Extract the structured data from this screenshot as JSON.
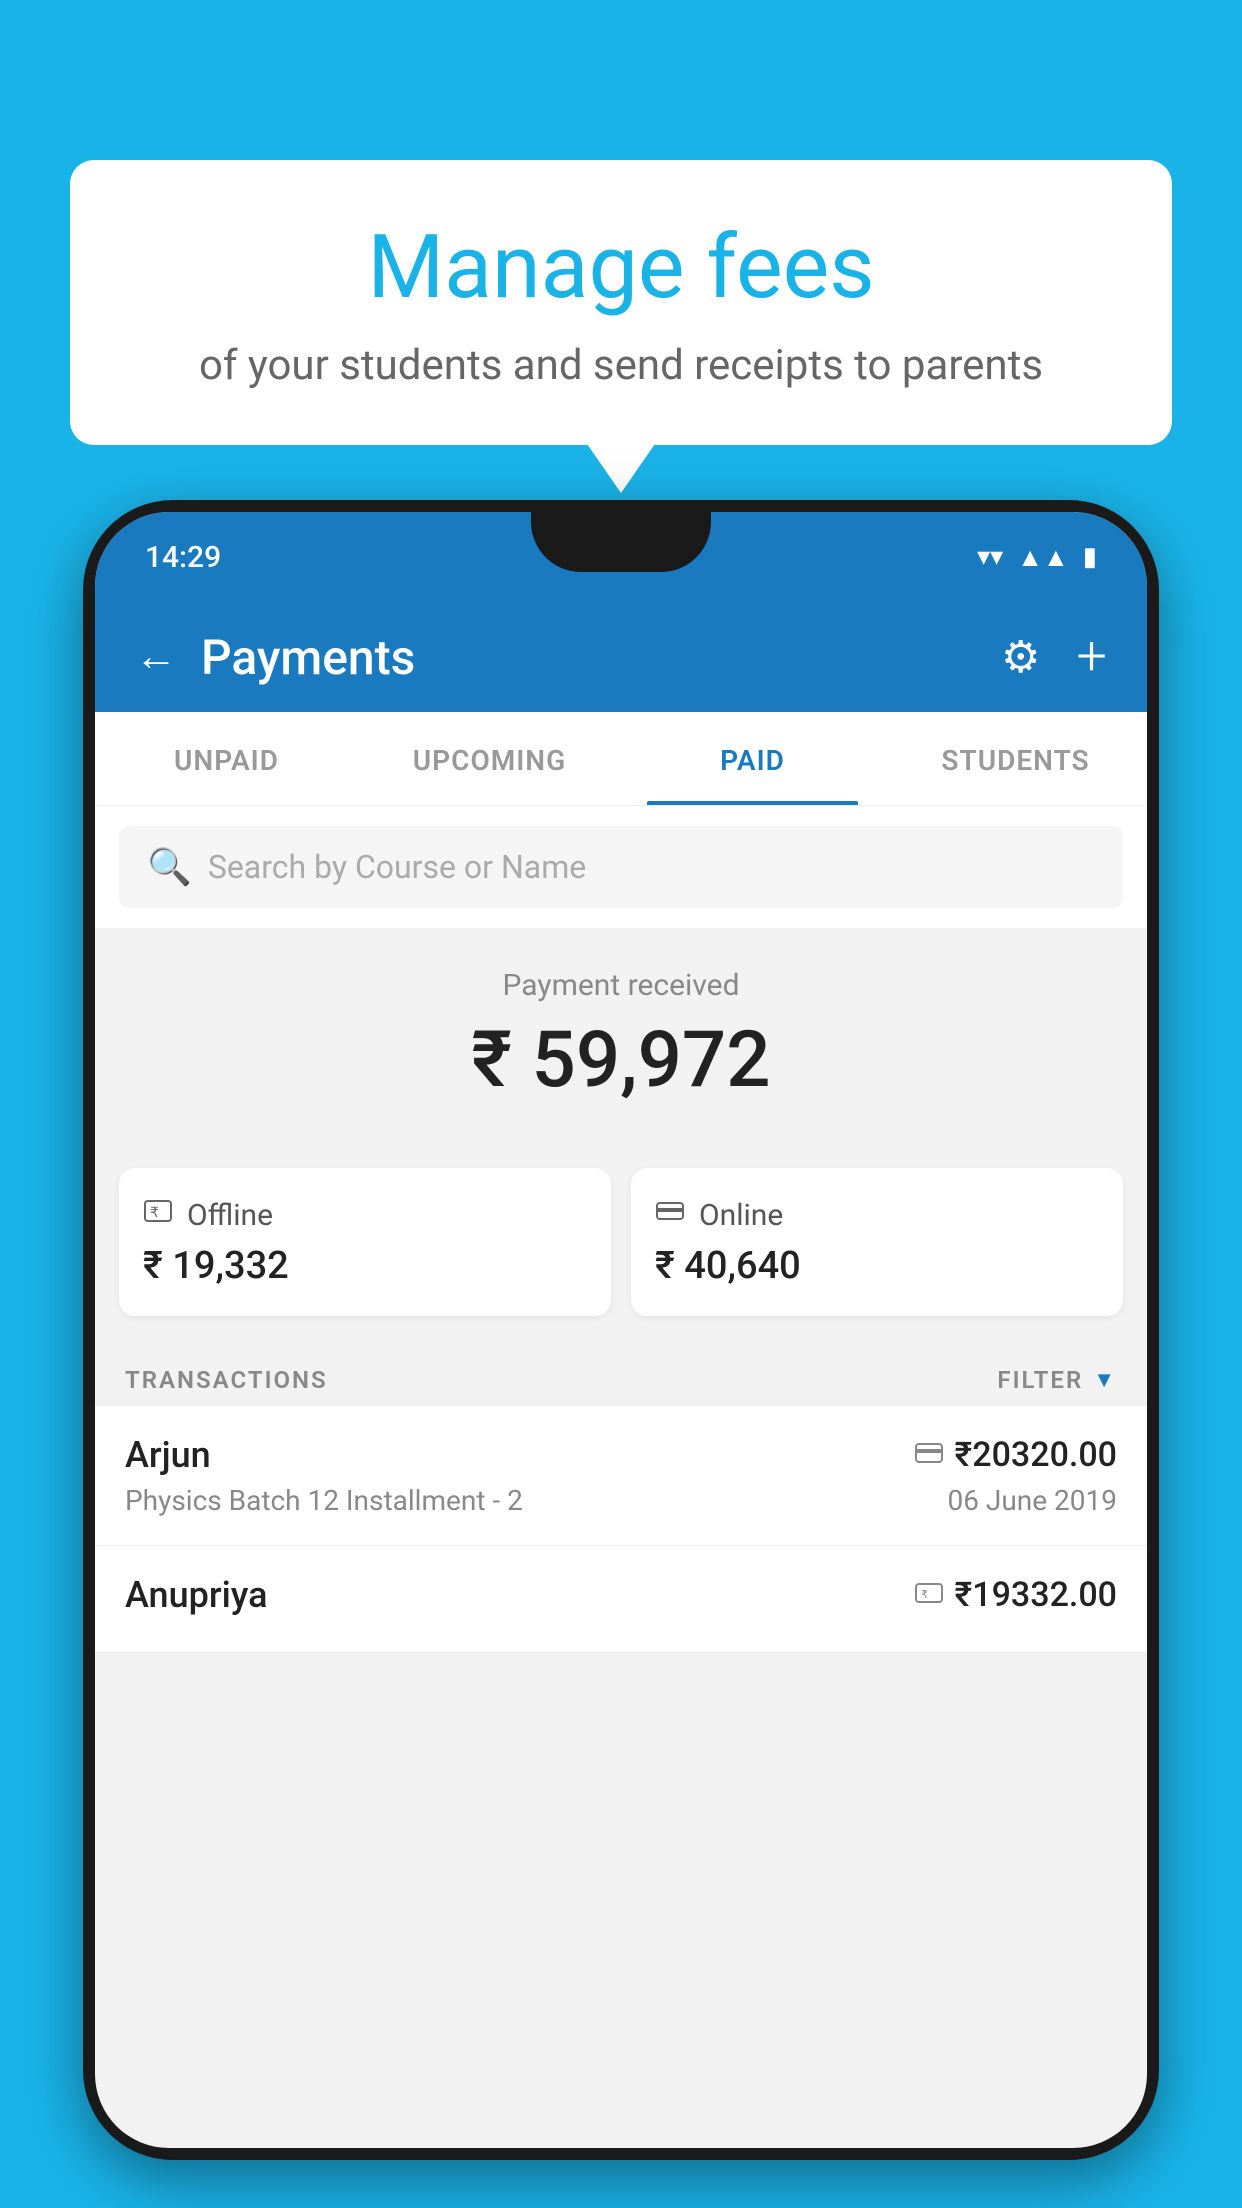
{
  "background_color": "#1ab3e8",
  "speech_bubble": {
    "title": "Manage fees",
    "subtitle": "of your students and send receipts to parents"
  },
  "phone": {
    "status_bar": {
      "time": "14:29"
    },
    "header": {
      "title": "Payments",
      "back_label": "←",
      "gear_label": "⚙",
      "plus_label": "+"
    },
    "tabs": [
      {
        "label": "UNPAID",
        "active": false
      },
      {
        "label": "UPCOMING",
        "active": false
      },
      {
        "label": "PAID",
        "active": true
      },
      {
        "label": "STUDENTS",
        "active": false
      }
    ],
    "search": {
      "placeholder": "Search by Course or Name"
    },
    "payment_received": {
      "label": "Payment received",
      "amount": "₹ 59,972",
      "offline": {
        "icon": "💳",
        "label": "Offline",
        "amount": "₹ 19,332"
      },
      "online": {
        "icon": "💳",
        "label": "Online",
        "amount": "₹ 40,640"
      }
    },
    "transactions_header": {
      "label": "TRANSACTIONS",
      "filter_label": "FILTER"
    },
    "transactions": [
      {
        "name": "Arjun",
        "mode_icon": "💳",
        "amount": "₹20320.00",
        "course": "Physics Batch 12 Installment - 2",
        "date": "06 June 2019"
      },
      {
        "name": "Anupriya",
        "mode_icon": "💴",
        "amount": "₹19332.00",
        "course": "",
        "date": ""
      }
    ]
  }
}
